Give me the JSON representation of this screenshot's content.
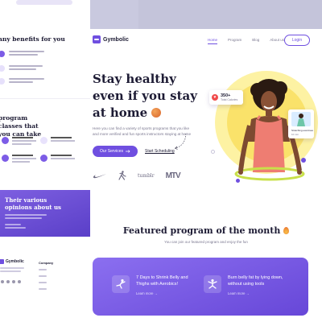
{
  "left_panel": {
    "benefits_title": "any benefits for you",
    "benefits": [
      {
        "line1": "You can follow the exercises",
        "line2": "easily at any time"
      },
      {
        "line1": "Be guided by professional",
        "line2": "trainers and coaches"
      },
      {
        "line1": "Track your progress and",
        "line2": "stay motivated"
      }
    ],
    "classes_title": "program classes that you can take",
    "testimonial_title": "Their various opinions about us",
    "footer_logo": "Gymbolic",
    "footer_col_title": "Company"
  },
  "nav": {
    "brand": "Gymbolic",
    "links": [
      "Home",
      "Program",
      "Blog",
      "About us"
    ],
    "login": "Login"
  },
  "hero": {
    "title": "Stay healthy even if you stay at home",
    "description": "Here you can find a variety of sports programs that you like and more verified and fun sports instructors staying at home",
    "primary_button": "Our Services",
    "secondary_link": "Start Scheduling",
    "brands": [
      "Nike",
      "Jordan",
      "tumblr",
      "MTV"
    ],
    "brand_tumblr": "tumblr",
    "brand_mtv": "MTV",
    "stat_value": "350+",
    "stat_label": "Total Calories",
    "card_line1": "Stretching exercises",
    "card_line2": "10 min"
  },
  "featured": {
    "title": "Featured program of the month",
    "subtitle": "You can join our featured program and enjoy the fun",
    "programs": [
      {
        "title": "7 Days to Shrink Belly and Thighs with Aerobics!",
        "more": "Learn more"
      },
      {
        "title": "Burn belly fat by lying down, without using tools",
        "more": "Learn more"
      }
    ]
  },
  "colors": {
    "accent": "#6f4fe0",
    "text_dark": "#1d1b34",
    "yellow": "#fae26a",
    "card_gradient_start": "#8b6ff0"
  }
}
